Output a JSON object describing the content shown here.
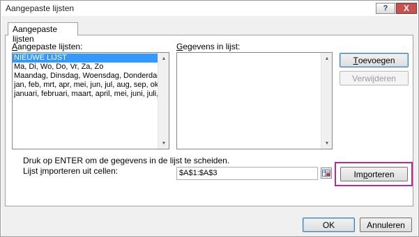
{
  "window": {
    "title": "Aangepaste lijsten",
    "help_label": "?",
    "close_label": "X"
  },
  "tab": {
    "label": "Aangepaste lijsten"
  },
  "custom_lists": {
    "label_first": "A",
    "label_rest": "angepaste lijsten:",
    "items": [
      "NIEUWE LIJST",
      "Ma, Di, Wo, Do, Vr, Za, Zo",
      "Maandag, Dinsdag, Woensdag, Donderdag, V",
      "jan, feb, mrt, apr, mei, jun, jul, aug, sep, okt, n",
      "januari, februari, maart, april, mei, juni, juli, a"
    ],
    "selected_index": 0
  },
  "list_entries": {
    "label_first": "G",
    "label_rest": "egevens in lijst:",
    "items": []
  },
  "buttons": {
    "add_first": "T",
    "add_rest": "oevoegen",
    "delete": "Verwijderen",
    "import_first": "Im",
    "import_u": "p",
    "import_rest": "orteren",
    "ok": "OK",
    "cancel": "Annuleren"
  },
  "instructions": "Druk op ENTER om de gegevens in de lijst te scheiden.",
  "import_label": {
    "before": "Lijst ",
    "u": "i",
    "after": "mporteren uit cellen:"
  },
  "import_range": {
    "value": "$A$1:$A$3"
  },
  "colors": {
    "selection": "#3399ff",
    "highlight": "#c0259a",
    "close_button": "#c75050"
  }
}
